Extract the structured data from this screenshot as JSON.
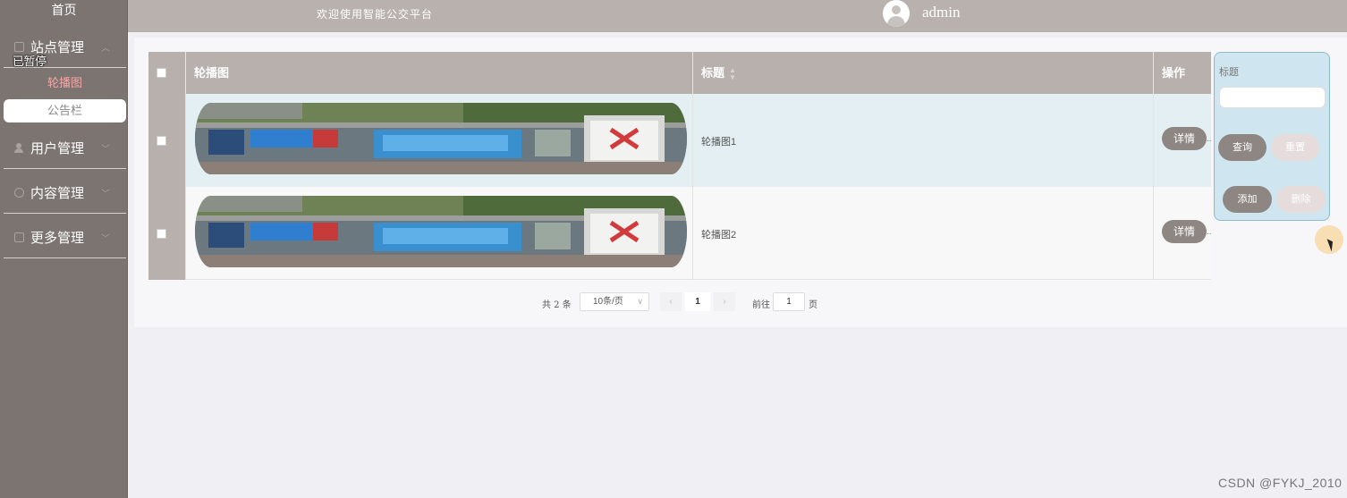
{
  "sidebar": {
    "home": "首页",
    "menus": [
      {
        "label": "站点管理",
        "icon": "square-icon"
      },
      {
        "label": "用户管理",
        "icon": "person-icon"
      },
      {
        "label": "内容管理",
        "icon": "chat-icon"
      },
      {
        "label": "更多管理",
        "icon": "copy-icon"
      }
    ],
    "submenu": [
      {
        "label": "轮播图",
        "active": true
      },
      {
        "label": "公告栏",
        "active": false
      }
    ],
    "overlay_text": "已暂停"
  },
  "topbar": {
    "welcome": "欢迎使用智能公交平台",
    "username": "admin"
  },
  "table": {
    "headers": [
      "轮播图",
      "标题",
      "操作"
    ],
    "rows": [
      {
        "title": "轮播图1",
        "action": "详情"
      },
      {
        "title": "轮播图2",
        "action": "详情"
      }
    ],
    "action_overflow": ".."
  },
  "pagination": {
    "total": "共 2 条",
    "page_size": "10条/页",
    "current_page": "1",
    "goto_label": "前往",
    "goto_value": "1",
    "goto_unit": "页"
  },
  "search": {
    "label": "标题",
    "query_button": "查询",
    "reset_button": "重置",
    "add_button": "添加",
    "delete_button": "删除"
  },
  "watermark": "CSDN @FYKJ_2010",
  "colors": {
    "sidebar_bg": "#7b7470",
    "header_bg": "#b9b1ad",
    "button_dark": "#8e8682",
    "active_sub": "#f4a7a7",
    "search_panel_bg": "#cfe5ef"
  }
}
